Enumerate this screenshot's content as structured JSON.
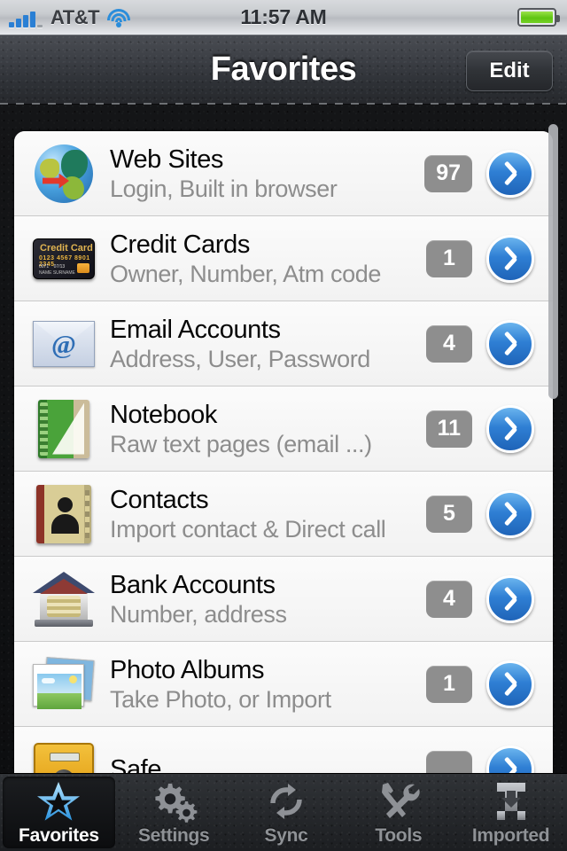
{
  "status_bar": {
    "carrier": "AT&T",
    "time": "11:57 AM",
    "signal_icon": "signal-bars-icon",
    "wifi_icon": "wifi-icon",
    "battery_icon": "battery-full-icon"
  },
  "nav_bar": {
    "title": "Favorites",
    "edit_label": "Edit"
  },
  "list": {
    "rows": [
      {
        "icon": "globe-icon",
        "title": "Web Sites",
        "subtitle": "Login, Built in browser",
        "count": "97"
      },
      {
        "icon": "credit-card-icon",
        "title": "Credit Cards",
        "subtitle": "Owner, Number, Atm code",
        "count": "1"
      },
      {
        "icon": "envelope-at-icon",
        "title": "Email Accounts",
        "subtitle": "Address, User, Password",
        "count": "4"
      },
      {
        "icon": "notebook-icon",
        "title": "Notebook",
        "subtitle": "Raw text pages (email ...)",
        "count": "11"
      },
      {
        "icon": "address-book-icon",
        "title": "Contacts",
        "subtitle": "Import contact & Direct call",
        "count": "5"
      },
      {
        "icon": "bank-icon",
        "title": "Bank Accounts",
        "subtitle": "Number, address",
        "count": "4"
      },
      {
        "icon": "photo-albums-icon",
        "title": "Photo Albums",
        "subtitle": "Take Photo, or Import",
        "count": "1"
      },
      {
        "icon": "safe-icon",
        "title": "Safe",
        "subtitle": "",
        "count": ""
      }
    ],
    "disclosure_icon": "chevron-right-icon"
  },
  "tab_bar": {
    "tabs": [
      {
        "label": "Favorites",
        "icon": "star-icon",
        "active": true
      },
      {
        "label": "Settings",
        "icon": "gears-icon",
        "active": false
      },
      {
        "label": "Sync",
        "icon": "refresh-icon",
        "active": false
      },
      {
        "label": "Tools",
        "icon": "tools-icon",
        "active": false
      },
      {
        "label": "Imported",
        "icon": "download-icon",
        "active": false
      }
    ]
  },
  "colors": {
    "badge_gray": "#8e8e8e",
    "disclosure_blue": "#2f7fd4",
    "active_tab_blue": "#5fc0f5",
    "leather_dark": "#141517"
  }
}
